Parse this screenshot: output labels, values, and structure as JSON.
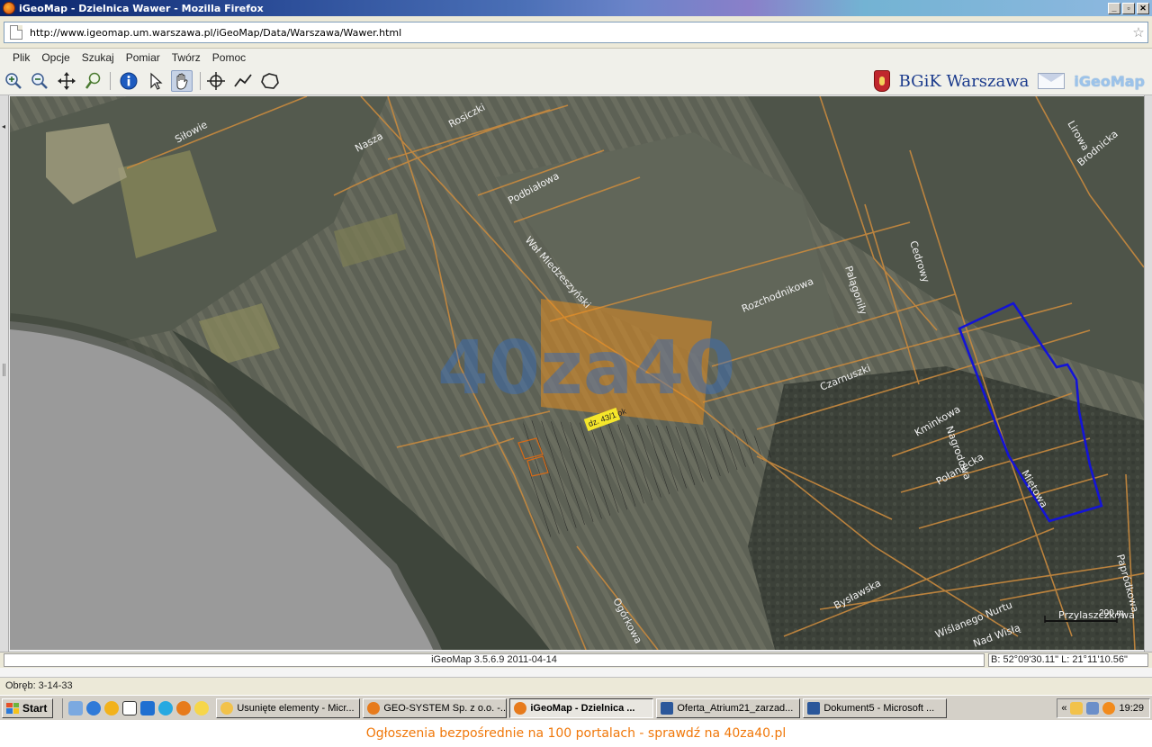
{
  "window": {
    "title": "iGeoMap - Dzielnica Wawer - Mozilla Firefox",
    "controls": [
      "_",
      "▫",
      "✕"
    ]
  },
  "address": {
    "url": "http://www.igeomap.um.warszawa.pl/iGeoMap/Data/Warszawa/Wawer.html"
  },
  "menu": {
    "items": [
      "Plik",
      "Opcje",
      "Szukaj",
      "Pomiar",
      "Twórz",
      "Pomoc"
    ]
  },
  "toolbar": {
    "tools": [
      "zoom-in-icon",
      "zoom-out-icon",
      "pan-all-icon",
      "search-zoom-icon",
      "info-icon",
      "pointer-icon",
      "hand-icon",
      "crosshair-icon",
      "polyline-icon",
      "polygon-icon"
    ],
    "brand_text": "BGiK Warszawa",
    "brand_logo": "iGeoMap",
    "crest_icon": "warsaw-crest-icon",
    "mail_icon": "envelope-icon"
  },
  "map": {
    "watermark": "40za40",
    "parcel_label": "dz. 43/1 ok",
    "street_labels": [
      "Siłowie",
      "Rosiczki",
      "Nasza",
      "Podbiałowa",
      "Wał Miedzeszyński",
      "Rozchodnikowa",
      "Palągoniły",
      "Cedrowy",
      "Czarnuszki",
      "Kminkowa",
      "Nagrodowa",
      "Połaniecka",
      "Miętowa",
      "Bysławska",
      "Wiślanego Nurtu",
      "Nad Wisłą",
      "Ogórkowa",
      "Lirowa",
      "Brodnicka",
      "Przylaszczkowa",
      "Papródkowa"
    ],
    "scale_label": "200 m",
    "colors": {
      "highlight": "#1414d6",
      "roads": "#c98a3e",
      "watermark_orange": "#f0901a",
      "watermark_blue": "#2f6fd1"
    }
  },
  "map_status": {
    "version": "iGeoMap 3.5.6.9 2011-04-14",
    "coords": "B: 52°09'30.11\" L: 21°11'10.56\""
  },
  "status": {
    "text": "Obręb: 3-14-33"
  },
  "taskbar": {
    "start_label": "Start",
    "tasks": [
      {
        "label": "Usunięte elementy - Micr...",
        "active": false
      },
      {
        "label": "GEO-SYSTEM Sp. z o.o. -...",
        "active": false
      },
      {
        "label": "iGeoMap - Dzielnica ...",
        "active": true
      },
      {
        "label": "Oferta_Atrium21_zarzad...",
        "active": false
      },
      {
        "label": "Dokument5 - Microsoft ...",
        "active": false
      }
    ],
    "clock": "19:29",
    "tray_chevron": "«"
  },
  "footer": {
    "text": "Ogłoszenia bezpośrednie na 100 portalach - sprawdź na 40za40.pl"
  }
}
